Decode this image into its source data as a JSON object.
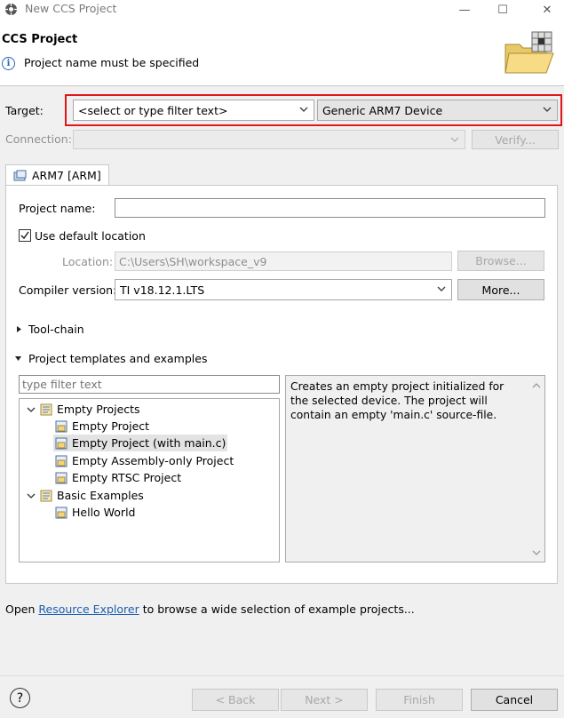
{
  "window": {
    "title": "New CCS Project",
    "minimize": "—",
    "maximize": "☐",
    "close": "✕"
  },
  "header": {
    "title": "CCS Project",
    "message": "Project name must be specified"
  },
  "target": {
    "label": "Target:",
    "filter_value": "<select or type filter text>",
    "device_value": "Generic ARM7 Device"
  },
  "connection": {
    "label": "Connection:",
    "verify": "Verify..."
  },
  "tab": {
    "label": "ARM7 [ARM]"
  },
  "form": {
    "project_name_label": "Project name:",
    "project_name_value": "",
    "use_default_location_label": "Use default location",
    "use_default_location_checked": true,
    "location_label": "Location:",
    "location_value": "C:\\Users\\SH\\workspace_v9",
    "browse": "Browse...",
    "compiler_label": "Compiler version:",
    "compiler_value": "TI v18.12.1.LTS",
    "more": "More..."
  },
  "sections": {
    "toolchain": "Tool-chain",
    "templates": "Project templates and examples"
  },
  "templates": {
    "filter_placeholder": "type filter text",
    "groups": [
      {
        "label": "Empty Projects",
        "items": [
          "Empty Project",
          "Empty Project (with main.c)",
          "Empty Assembly-only Project",
          "Empty RTSC Project"
        ]
      },
      {
        "label": "Basic Examples",
        "items": [
          "Hello World"
        ]
      }
    ],
    "selected": "Empty Project (with main.c)",
    "description": "Creates an empty project initialized for the selected device. The project will contain an empty 'main.c' source-file."
  },
  "footer_text": {
    "before": "Open ",
    "link": "Resource Explorer",
    "after": " to browse a wide selection of example projects..."
  },
  "buttons": {
    "help": "?",
    "back": "< Back",
    "next": "Next >",
    "finish": "Finish",
    "cancel": "Cancel"
  },
  "colors": {
    "highlight_box": "#e0161b",
    "link": "#1c5fb1"
  }
}
